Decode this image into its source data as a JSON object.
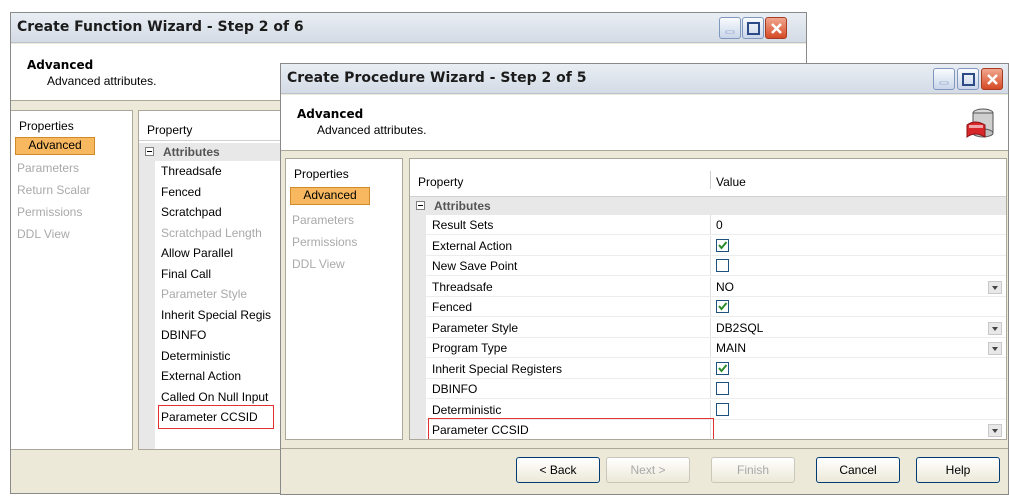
{
  "function_wizard": {
    "title": "Create Function Wizard - Step 2 of 6",
    "header_title": "Advanced",
    "header_subtitle": "Advanced attributes.",
    "nav_heading": "Properties",
    "nav_items": [
      "Advanced",
      "Parameters",
      "Return Scalar",
      "Permissions",
      "DDL View"
    ],
    "grid_column_property": "Property",
    "category": "Attributes",
    "rows": [
      "Threadsafe",
      "Fenced",
      "Scratchpad",
      "Scratchpad Length",
      "Allow Parallel",
      "Final Call",
      "Parameter Style",
      "Inherit Special Regis",
      "DBINFO",
      "Deterministic",
      "External Action",
      "Called On Null Input",
      "Parameter CCSID"
    ]
  },
  "procedure_wizard": {
    "title": "Create Procedure Wizard - Step 2 of 5",
    "header_title": "Advanced",
    "header_subtitle": "Advanced attributes.",
    "nav_heading": "Properties",
    "nav_items": [
      "Advanced",
      "Parameters",
      "Permissions",
      "DDL View"
    ],
    "grid_column_property": "Property",
    "grid_column_value": "Value",
    "category": "Attributes",
    "rows": [
      {
        "name": "Result Sets",
        "value": "0",
        "kind": "text"
      },
      {
        "name": "External Action",
        "checked": true,
        "kind": "check"
      },
      {
        "name": "New Save Point",
        "checked": false,
        "kind": "check"
      },
      {
        "name": "Threadsafe",
        "value": "NO",
        "kind": "dropdown"
      },
      {
        "name": "Fenced",
        "checked": true,
        "kind": "check"
      },
      {
        "name": "Parameter Style",
        "value": "DB2SQL",
        "kind": "dropdown"
      },
      {
        "name": "Program Type",
        "value": "MAIN",
        "kind": "dropdown"
      },
      {
        "name": "Inherit Special Registers",
        "checked": true,
        "kind": "check"
      },
      {
        "name": "DBINFO",
        "checked": false,
        "kind": "check"
      },
      {
        "name": "Deterministic",
        "checked": false,
        "kind": "check"
      },
      {
        "name": "Parameter CCSID",
        "value": "",
        "kind": "dropdown"
      }
    ],
    "buttons": {
      "back": "< Back",
      "next": "Next >",
      "finish": "Finish",
      "cancel": "Cancel",
      "help": "Help"
    }
  },
  "colors": {
    "accent": "#f7b860",
    "highlight_border": "#e0322f",
    "check": "#2a8a2a"
  }
}
